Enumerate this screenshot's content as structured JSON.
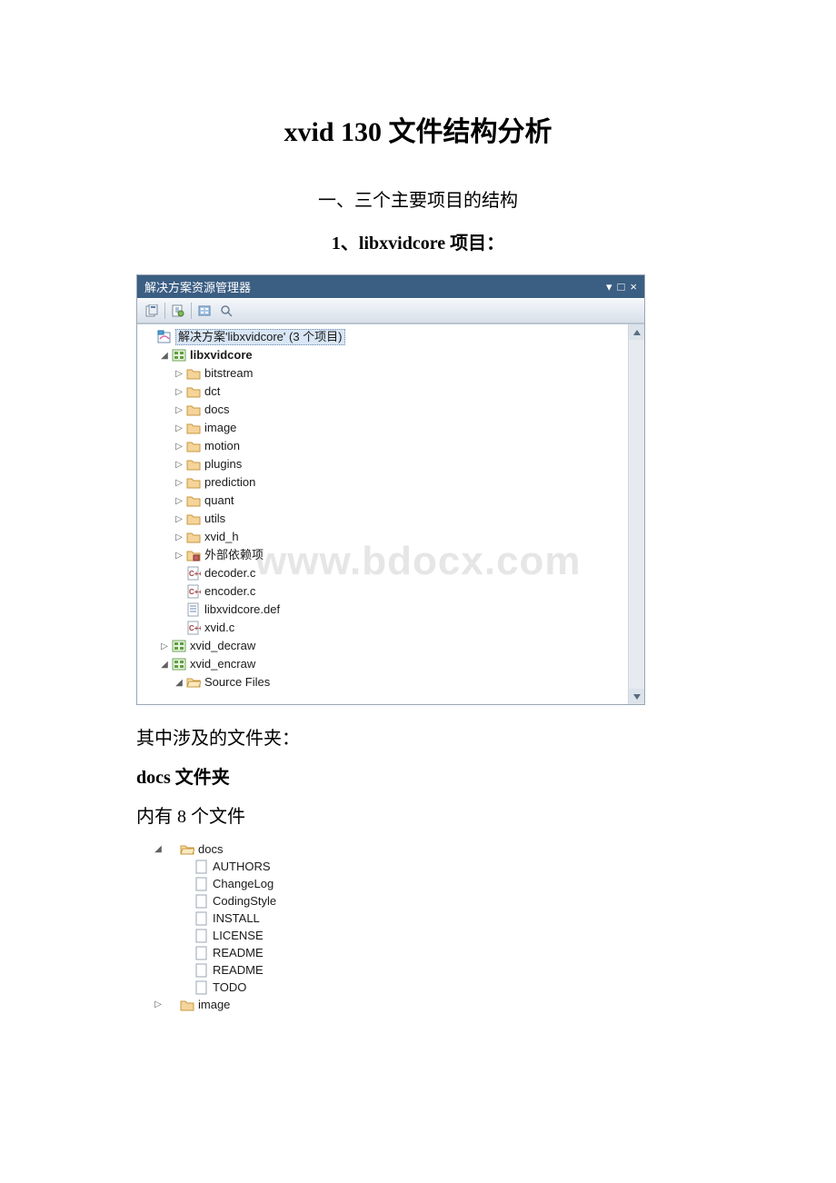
{
  "title": "xvid 130 文件结构分析",
  "section1": "一、三个主要项目的结构",
  "subsection1": "1、libxvidcore 项目：",
  "panel": {
    "title": "解决方案资源管理器",
    "title_controls": {
      "menu": "▾",
      "window": "□",
      "close": "×"
    },
    "root": "解决方案'libxvidcore' (3 个项目)",
    "project1": "libxvidcore",
    "folders": [
      "bitstream",
      "dct",
      "docs",
      "image",
      "motion",
      "plugins",
      "prediction",
      "quant",
      "utils",
      "xvid_h"
    ],
    "ext_deps": "外部依赖项",
    "files": [
      "decoder.c",
      "encoder.c",
      "libxvidcore.def",
      "xvid.c"
    ],
    "project2": "xvid_decraw",
    "project3": "xvid_encraw",
    "source_files": "Source Files"
  },
  "watermark": "www.bdocx.com",
  "para1": "其中涉及的文件夹：",
  "para2": "docs 文件夹",
  "para3": "内有 8 个文件",
  "docs": {
    "folder": "docs",
    "items": [
      "AUTHORS",
      "ChangeLog",
      "CodingStyle",
      "INSTALL",
      "LICENSE",
      "README",
      "README",
      "TODO"
    ],
    "next": "image"
  }
}
